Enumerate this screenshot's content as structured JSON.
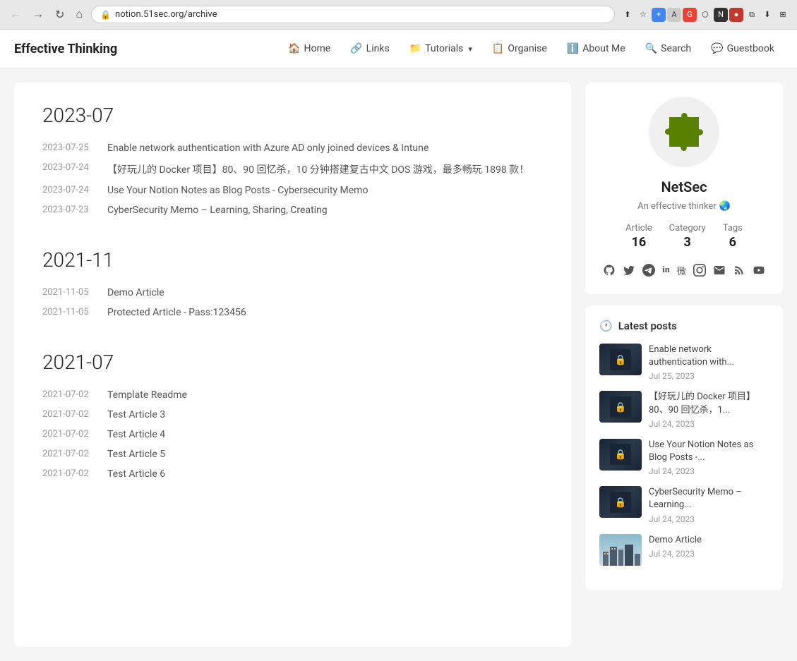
{
  "browser": {
    "url": "notion.51sec.org/archive",
    "back_label": "←",
    "forward_label": "→",
    "reload_label": "↻",
    "home_label": "⌂"
  },
  "site": {
    "logo": "Effective Thinking",
    "nav": [
      {
        "id": "home",
        "icon": "🏠",
        "label": "Home"
      },
      {
        "id": "links",
        "icon": "🔗",
        "label": "Links"
      },
      {
        "id": "tutorials",
        "icon": "📁",
        "label": "Tutorials",
        "has_dropdown": true
      },
      {
        "id": "organise",
        "icon": "📋",
        "label": "Organise"
      },
      {
        "id": "about",
        "icon": "ℹ️",
        "label": "About Me"
      },
      {
        "id": "search",
        "icon": "🔍",
        "label": "Search"
      },
      {
        "id": "guestbook",
        "icon": "💬",
        "label": "Guestbook"
      }
    ]
  },
  "archive": {
    "sections": [
      {
        "year_month": "2023-07",
        "posts": [
          {
            "date": "2023-07-25",
            "title": "Enable network authentication with Azure AD only joined devices & Intune"
          },
          {
            "date": "2023-07-24",
            "title": "【好玩儿的 Docker 项目】80、90 回忆杀，10 分钟搭建复古中文 DOS 游戏，最多畅玩 1898 款！"
          },
          {
            "date": "2023-07-24",
            "title": "Use Your Notion Notes as Blog Posts - Cybersecurity Memo"
          },
          {
            "date": "2023-07-23",
            "title": "CyberSecurity Memo – Learning, Sharing, Creating"
          }
        ]
      },
      {
        "year_month": "2021-11",
        "posts": [
          {
            "date": "2021-11-05",
            "title": "Demo Article"
          },
          {
            "date": "2021-11-05",
            "title": "Protected Article - Pass:123456"
          }
        ]
      },
      {
        "year_month": "2021-07",
        "posts": [
          {
            "date": "2021-07-02",
            "title": "Template Readme"
          },
          {
            "date": "2021-07-02",
            "title": "Test Article 3"
          },
          {
            "date": "2021-07-02",
            "title": "Test Article 4"
          },
          {
            "date": "2021-07-02",
            "title": "Test Article 5"
          },
          {
            "date": "2021-07-02",
            "title": "Test Article 6"
          }
        ]
      }
    ]
  },
  "profile": {
    "name": "NetSec",
    "bio": "An effective thinker",
    "bio_emoji": "🌏",
    "stats": [
      {
        "label": "Article",
        "value": "16"
      },
      {
        "label": "Category",
        "value": "3"
      },
      {
        "label": "Tags",
        "value": "6"
      }
    ],
    "social_links": [
      {
        "id": "github",
        "icon": "⊙",
        "label": "GitHub"
      },
      {
        "id": "twitter",
        "icon": "𝕏",
        "label": "Twitter"
      },
      {
        "id": "telegram",
        "icon": "✈",
        "label": "Telegram"
      },
      {
        "id": "linkedin",
        "icon": "in",
        "label": "LinkedIn"
      },
      {
        "id": "weibo",
        "icon": "微",
        "label": "Weibo"
      },
      {
        "id": "instagram",
        "icon": "◎",
        "label": "Instagram"
      },
      {
        "id": "email",
        "icon": "✉",
        "label": "Email"
      },
      {
        "id": "rss",
        "icon": "◉",
        "label": "RSS"
      },
      {
        "id": "youtube",
        "icon": "▶",
        "label": "YouTube"
      }
    ]
  },
  "latest_posts": {
    "title": "Latest posts",
    "posts": [
      {
        "title": "Enable network authentication with...",
        "date": "Jul 25, 2023",
        "thumb_type": "dark"
      },
      {
        "title": "【好玩儿的 Docker 项目】80、90 回忆杀，1...",
        "date": "Jul 24, 2023",
        "thumb_type": "dark"
      },
      {
        "title": "Use Your Notion Notes as Blog Posts -...",
        "date": "Jul 24, 2023",
        "thumb_type": "dark"
      },
      {
        "title": "CyberSecurity Memo – Learning...",
        "date": "Jul 24, 2023",
        "thumb_type": "dark"
      },
      {
        "title": "Demo Article",
        "date": "Jul 24, 2023",
        "thumb_type": "city"
      }
    ]
  }
}
